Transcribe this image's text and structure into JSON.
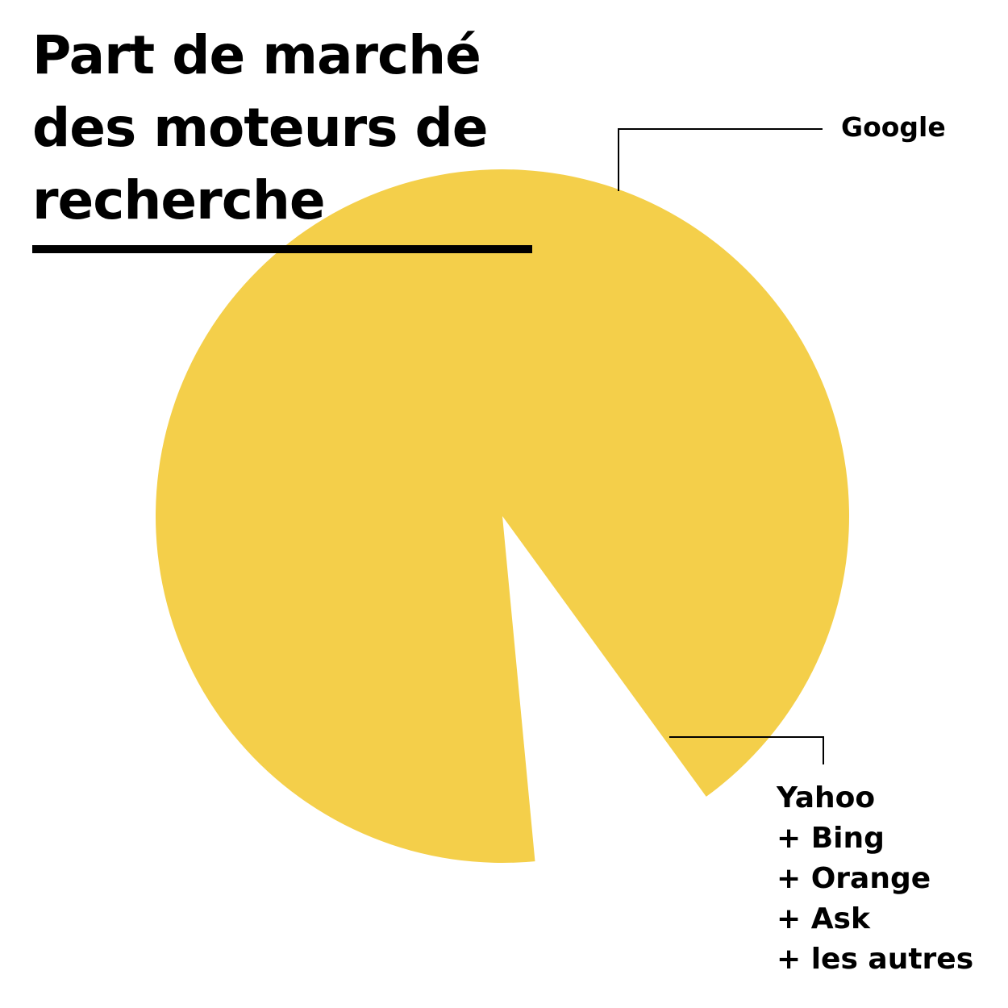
{
  "title": {
    "line1": "Part de marché",
    "line2": "des moteurs de",
    "line3": "recherche"
  },
  "colors": {
    "slice": "#F4CF4A",
    "background": "#FFFFFF",
    "text": "#000000"
  },
  "chart_data": {
    "type": "pie",
    "title": "Part de marché des moteurs de recherche",
    "slices": [
      {
        "name": "Google",
        "value": 91.5,
        "color": "#F4CF4A",
        "label_lines": [
          "Google"
        ]
      },
      {
        "name": "Yahoo + Bing + Orange + Ask + les autres",
        "value": 8.5,
        "color": "#FFFFFF",
        "label_lines": [
          "Yahoo",
          "+ Bing",
          "+ Orange",
          "+ Ask",
          "+ les autres"
        ]
      }
    ],
    "legend": "none"
  }
}
